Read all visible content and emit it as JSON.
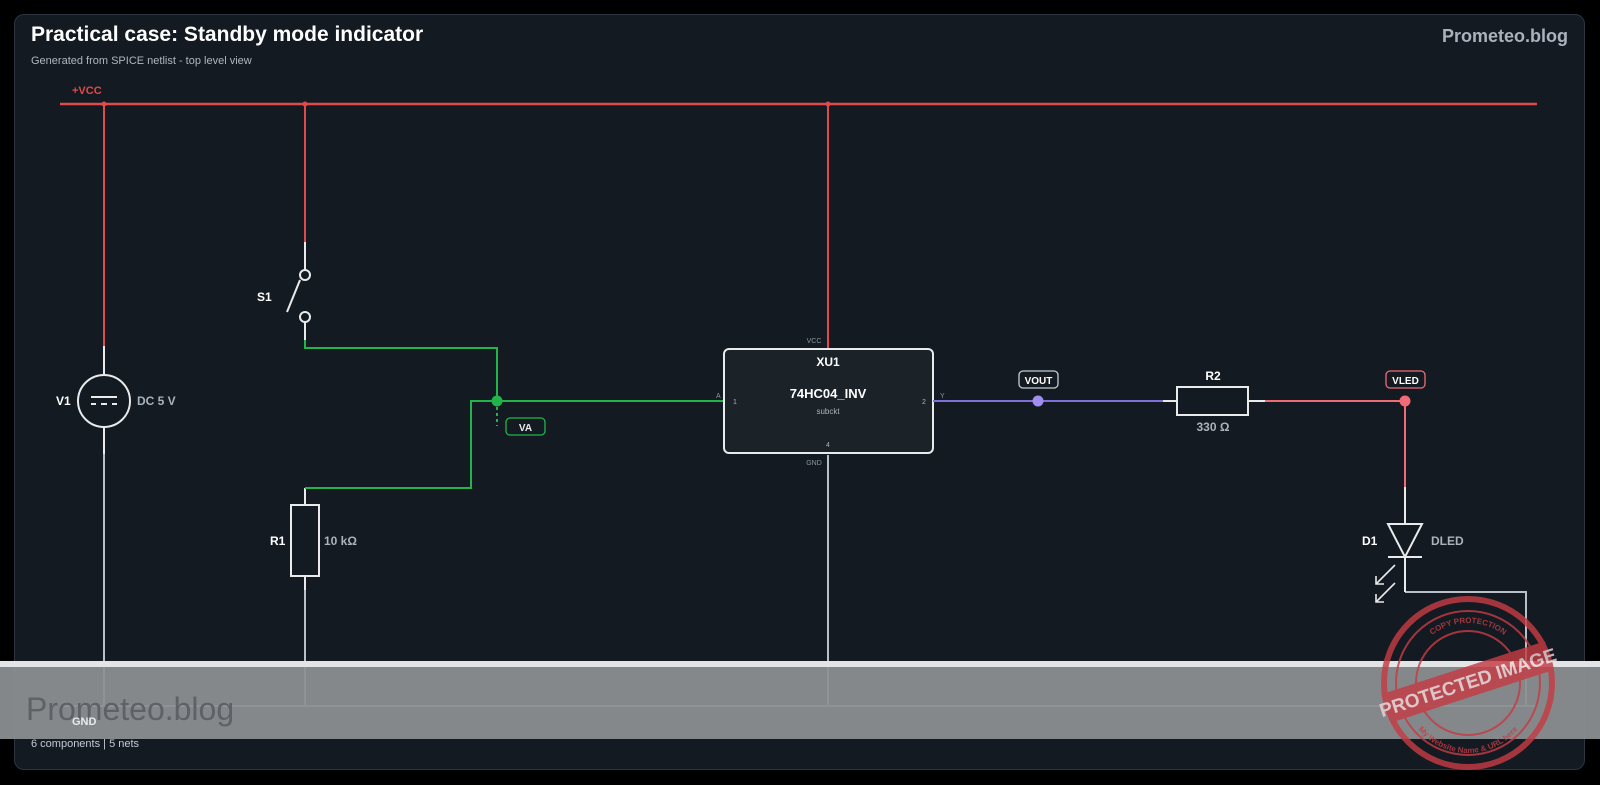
{
  "header": {
    "title": "Practical case: Standby mode indicator",
    "subtitle": "Generated from SPICE netlist - top level view",
    "brand": "Prometeo.blog"
  },
  "footer": {
    "summary": "6 components | 5 nets"
  },
  "nets": {
    "vcc": {
      "label": "+VCC",
      "color": "#e04a4a"
    },
    "gnd": {
      "label": "GND",
      "color": "#b7c0c9"
    },
    "va": {
      "label": "VA",
      "color": "#22b34a"
    },
    "vout": {
      "label": "VOUT",
      "color": "#7f6fd9"
    },
    "vled": {
      "label": "VLED",
      "color": "#f06b76"
    }
  },
  "components": {
    "v1": {
      "ref": "V1",
      "value": "DC 5 V"
    },
    "s1": {
      "ref": "S1"
    },
    "r1": {
      "ref": "R1",
      "value": "10 kΩ"
    },
    "xu1": {
      "ref": "XU1",
      "model": "74HC04_INV",
      "kind": "subckt",
      "pins": {
        "vcc": "VCC",
        "gnd": "GND",
        "a": "A",
        "y": "Y",
        "p1": "1",
        "p2": "2",
        "p4": "4"
      }
    },
    "r2": {
      "ref": "R2",
      "value": "330 Ω"
    },
    "d1": {
      "ref": "D1",
      "value": "DLED"
    }
  },
  "watermark": {
    "text": "Prometeo.blog",
    "stamp_main": "PROTECTED IMAGE",
    "stamp_top": "COPY PROTECTION",
    "stamp_bottom": "My Website Name & URL here"
  }
}
